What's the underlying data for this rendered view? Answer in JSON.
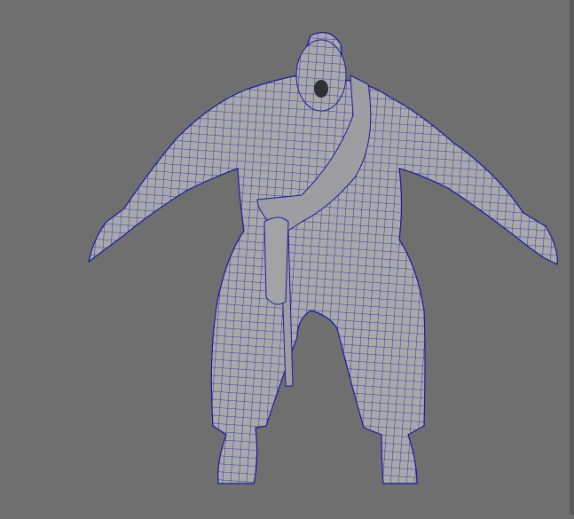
{
  "viewport": {
    "background_color": "#6f6f6f",
    "mesh_fill_color": "#a9a9ab",
    "wireframe_color": "#1a1aa0",
    "display_mode": "wireframe-on-shaded"
  }
}
